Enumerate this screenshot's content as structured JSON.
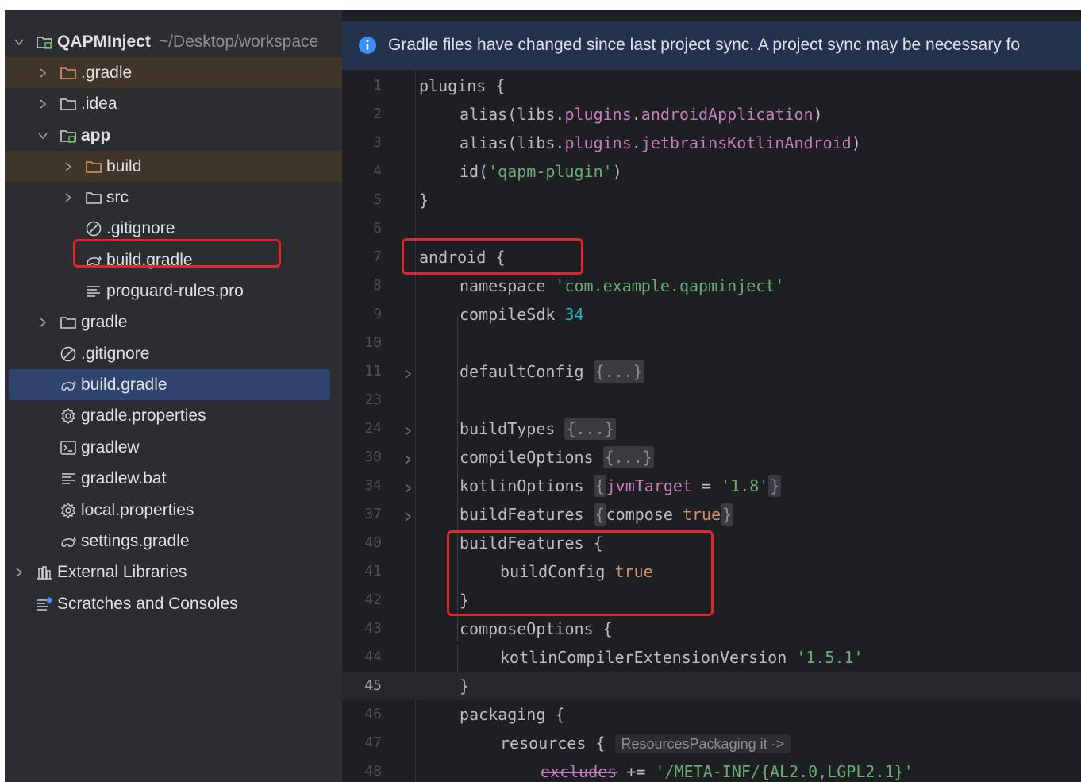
{
  "project_tree": {
    "root": {
      "name": "QAPMInject",
      "path": "~/Desktop/workspace"
    },
    "items": [
      {
        "label": ".gradle",
        "icon": "folder-icon"
      },
      {
        "label": ".idea",
        "icon": "folder-icon"
      },
      {
        "label": "app",
        "icon": "module-folder-icon"
      },
      {
        "label": "build",
        "icon": "folder-icon"
      },
      {
        "label": "src",
        "icon": "folder-icon"
      },
      {
        "label": ".gitignore",
        "icon": "ignore-file-icon"
      },
      {
        "label": "build.gradle",
        "icon": "gradle-file-icon"
      },
      {
        "label": "proguard-rules.pro",
        "icon": "text-file-icon"
      },
      {
        "label": "gradle",
        "icon": "folder-icon"
      },
      {
        "label": ".gitignore",
        "icon": "ignore-file-icon"
      },
      {
        "label": "build.gradle",
        "icon": "gradle-file-icon"
      },
      {
        "label": "gradle.properties",
        "icon": "settings-file-icon"
      },
      {
        "label": "gradlew",
        "icon": "terminal-file-icon"
      },
      {
        "label": "gradlew.bat",
        "icon": "text-file-icon"
      },
      {
        "label": "local.properties",
        "icon": "settings-file-icon"
      },
      {
        "label": "settings.gradle",
        "icon": "gradle-file-icon"
      },
      {
        "label": "External Libraries",
        "icon": "library-icon"
      },
      {
        "label": "Scratches and Consoles",
        "icon": "scratches-icon"
      }
    ]
  },
  "banner": {
    "text": "Gradle files have changed since last project sync. A project sync may be necessary fo"
  },
  "editor": {
    "line_numbers": [
      "1",
      "2",
      "3",
      "4",
      "5",
      "6",
      "7",
      "8",
      "9",
      "10",
      "11",
      "23",
      "24",
      "30",
      "34",
      "37",
      "40",
      "41",
      "42",
      "43",
      "44",
      "45",
      "46",
      "47",
      "48"
    ],
    "current_line": "45",
    "tokens": {
      "l1": [
        "plugins {"
      ],
      "l2": [
        "alias(libs.",
        "plugins",
        ".",
        "androidApplication",
        ")"
      ],
      "l3": [
        "alias(libs.",
        "plugins",
        ".",
        "jetbrainsKotlinAndroid",
        ")"
      ],
      "l4": [
        "id(",
        "'qapm-plugin'",
        ")"
      ],
      "l5": [
        "}"
      ],
      "l7": [
        "android {"
      ],
      "l8": [
        "namespace ",
        "'com.example.qapminject'"
      ],
      "l9": [
        "compileSdk ",
        "34"
      ],
      "l11": [
        "defaultConfig ",
        "{...}"
      ],
      "l24": [
        "buildTypes ",
        "{...}"
      ],
      "l30": [
        "compileOptions ",
        "{...}"
      ],
      "l34": [
        "kotlinOptions ",
        "{",
        "jvmTarget",
        " = ",
        "'1.8'",
        "}"
      ],
      "l37": [
        "buildFeatures ",
        "{",
        "compose ",
        "true",
        "}"
      ],
      "l40": [
        "buildFeatures {"
      ],
      "l41": [
        "buildConfig ",
        "true"
      ],
      "l42": [
        "}"
      ],
      "l43": [
        "composeOptions {"
      ],
      "l44": [
        "kotlinCompilerExtensionVersion ",
        "'1.5.1'"
      ],
      "l45": [
        "}"
      ],
      "l46": [
        "packaging {"
      ],
      "l47": [
        "resources { ",
        "ResourcesPackaging it ->"
      ],
      "l48": [
        "excludes",
        " += ",
        "'/META-INF/{AL2.0,LGPL2.1}'"
      ]
    }
  },
  "colors": {
    "sidebar_bg": "#2b2d30",
    "editor_bg": "#1e1f22",
    "banner_bg": "#25324d",
    "selection": "#2e436e",
    "excluded_folder": "#e2935d",
    "annotation_red": "#e3262d",
    "string": "#6aab73",
    "keyword": "#cf8e6d",
    "property": "#c77dbb",
    "number": "#2aacb8"
  }
}
